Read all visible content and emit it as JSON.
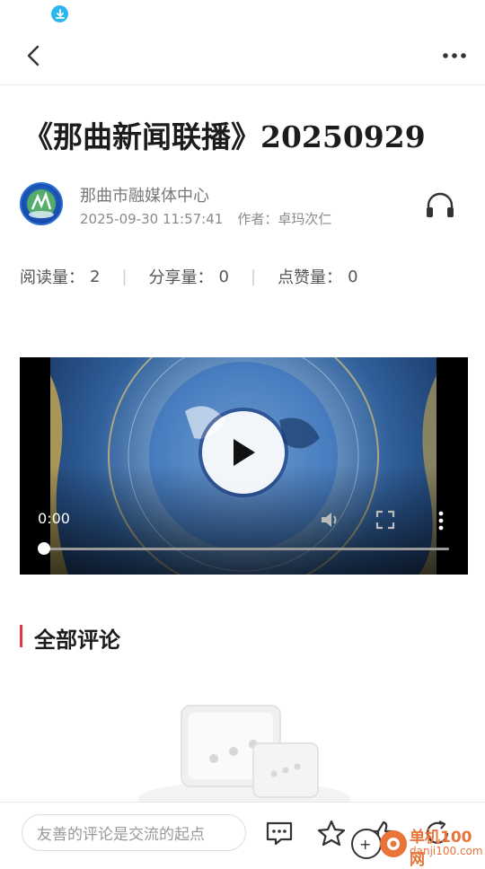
{
  "article": {
    "title": "《那曲新闻联播》20250929",
    "source": "那曲市融媒体中心",
    "datetime": "2025-09-30 11:57:41",
    "author": "作者：卓玛次仁"
  },
  "stats": {
    "read_label": "阅读量：",
    "read_value": "2",
    "share_label": "分享量：",
    "share_value": "0",
    "like_label": "点赞量：",
    "like_value": "0"
  },
  "video": {
    "current_time": "0:00",
    "progress": 0
  },
  "comments": {
    "section_title": "全部评论"
  },
  "bottom_bar": {
    "comment_placeholder": "友善的评论是交流的起点"
  },
  "watermark": {
    "line1": "单机100网",
    "line2": "danji100.com"
  },
  "colors": {
    "accent_red": "#e23a3a",
    "download_blue": "#2bb6f0",
    "watermark_orange": "#e8743a"
  }
}
